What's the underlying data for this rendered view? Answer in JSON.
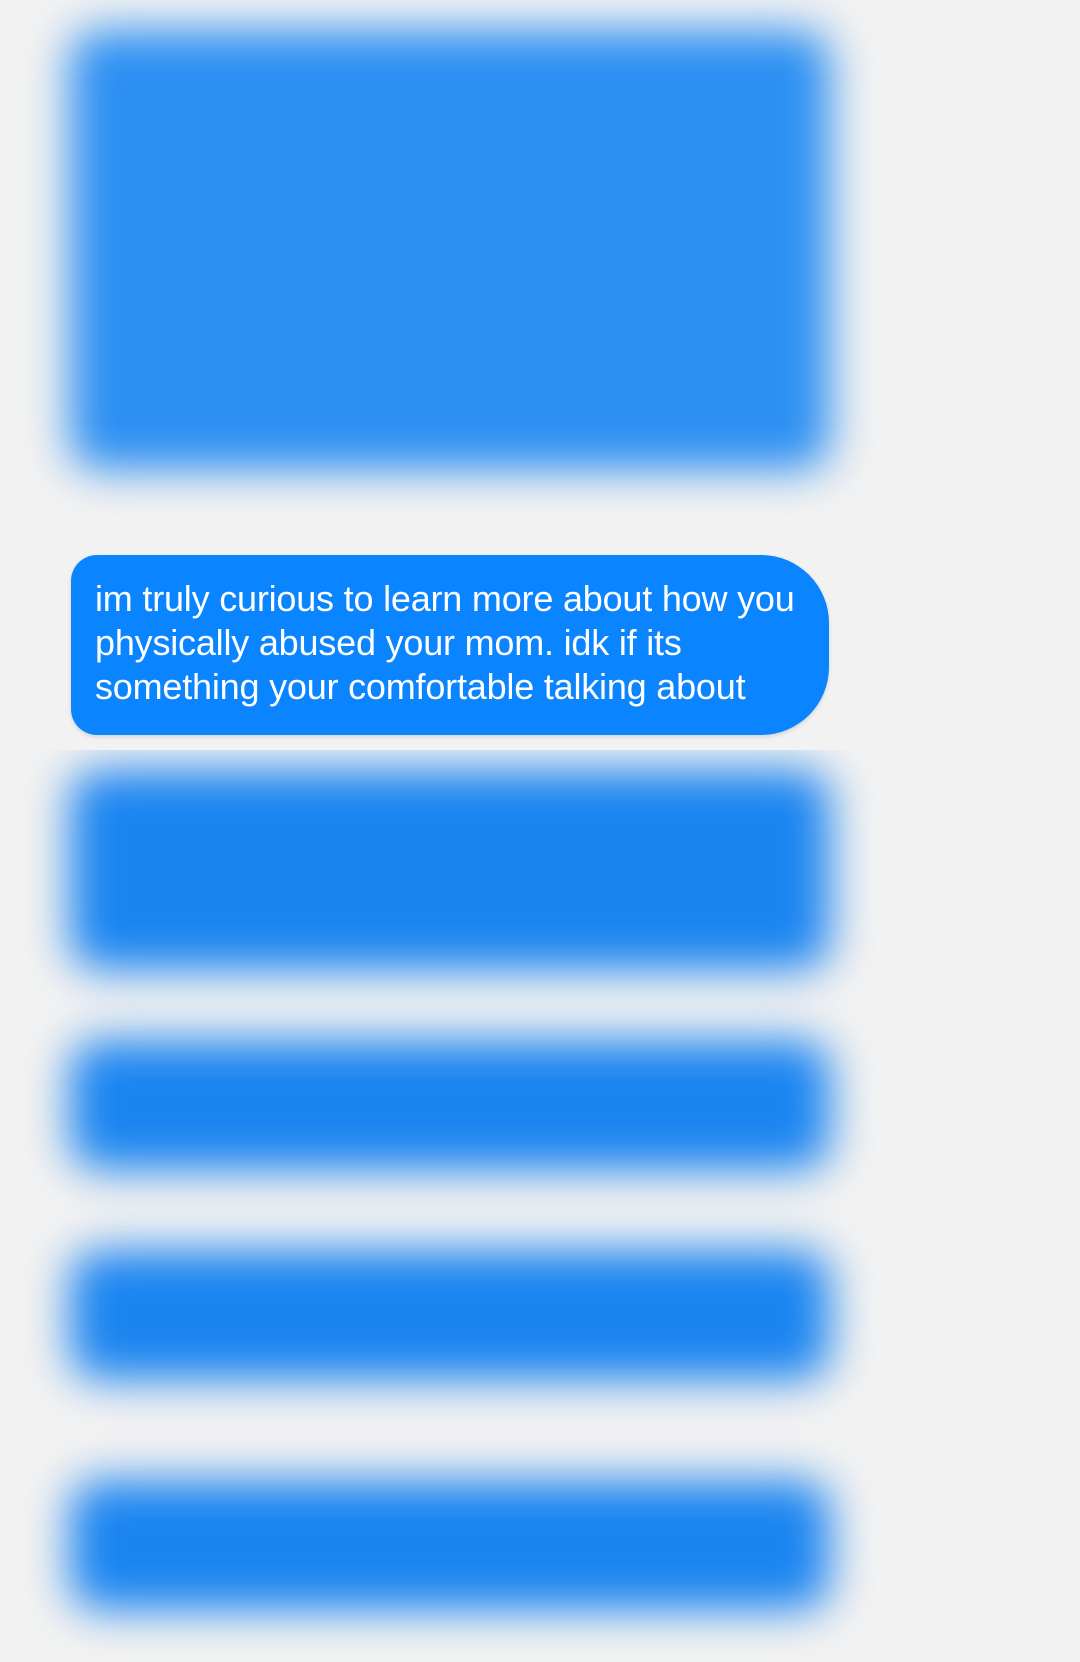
{
  "conversation": {
    "highlighted_message": {
      "text": "im truly curious to learn more about how you physically abused your mom. idk if its something your comfortable talking about"
    }
  },
  "colors": {
    "bubble": "#0a84ff",
    "background": "#f2f2f2"
  }
}
